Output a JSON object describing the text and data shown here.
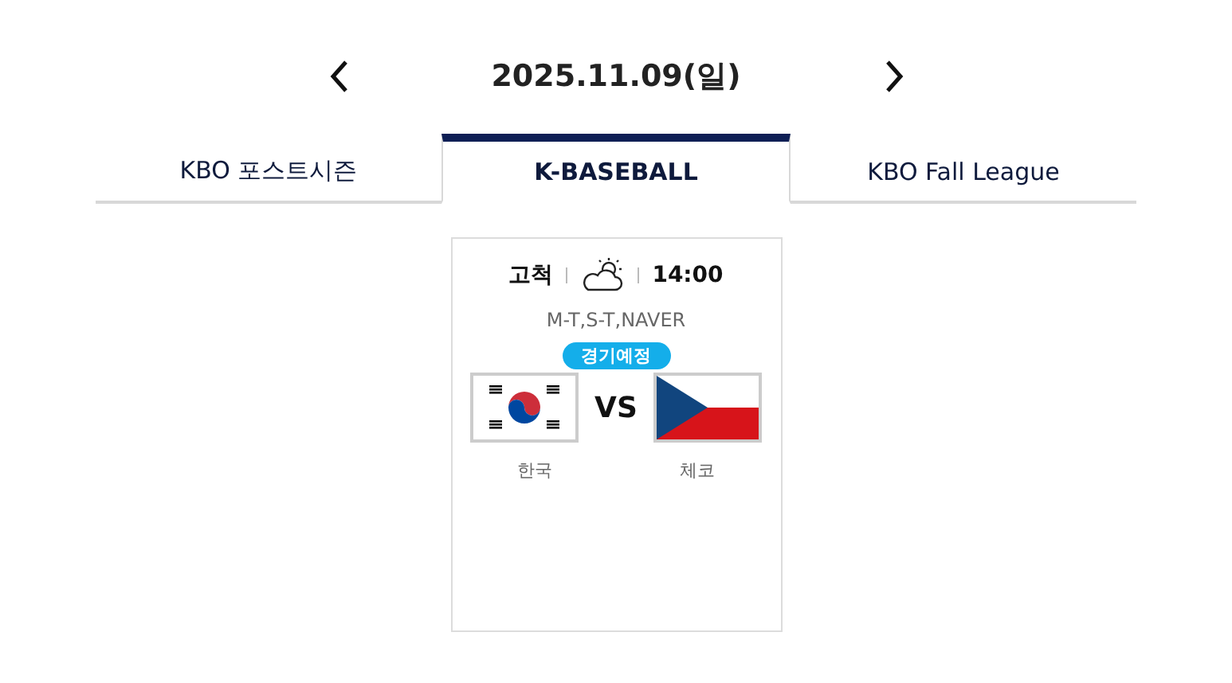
{
  "date": "2025.11.09(일)",
  "tabs": [
    {
      "label": "KBO 포스트시즌",
      "selected": false
    },
    {
      "label": "K-BASEBALL",
      "selected": true
    },
    {
      "label": "KBO Fall League",
      "selected": false
    }
  ],
  "game": {
    "stadium": "고척",
    "time": "14:00",
    "broadcast": "M-T,S-T,NAVER",
    "status": "경기예정",
    "versus": "VS",
    "teams": [
      {
        "name": "한국",
        "kind": "korea"
      },
      {
        "name": "체코",
        "kind": "czech"
      }
    ]
  }
}
